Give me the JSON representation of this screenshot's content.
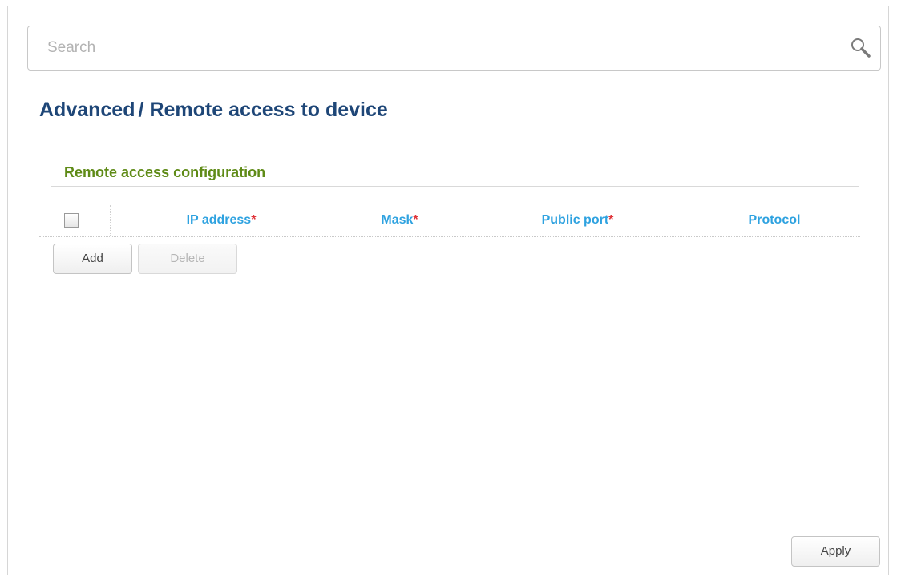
{
  "search": {
    "placeholder": "Search",
    "icon": "search-icon"
  },
  "breadcrumb": {
    "parent": "Advanced",
    "separator": "/",
    "current": "Remote access to device"
  },
  "section": {
    "title": "Remote access configuration"
  },
  "table": {
    "columns": [
      {
        "label": "IP address",
        "required_mark": "*"
      },
      {
        "label": "Mask",
        "required_mark": "*"
      },
      {
        "label": "Public port",
        "required_mark": "*"
      },
      {
        "label": "Protocol",
        "required_mark": ""
      }
    ],
    "rows": []
  },
  "buttons": {
    "add": "Add",
    "delete": "Delete",
    "apply": "Apply"
  },
  "colors": {
    "title": "#1e4677",
    "section": "#5f8b17",
    "column_header": "#2ea2e0",
    "required": "#e0353a"
  }
}
